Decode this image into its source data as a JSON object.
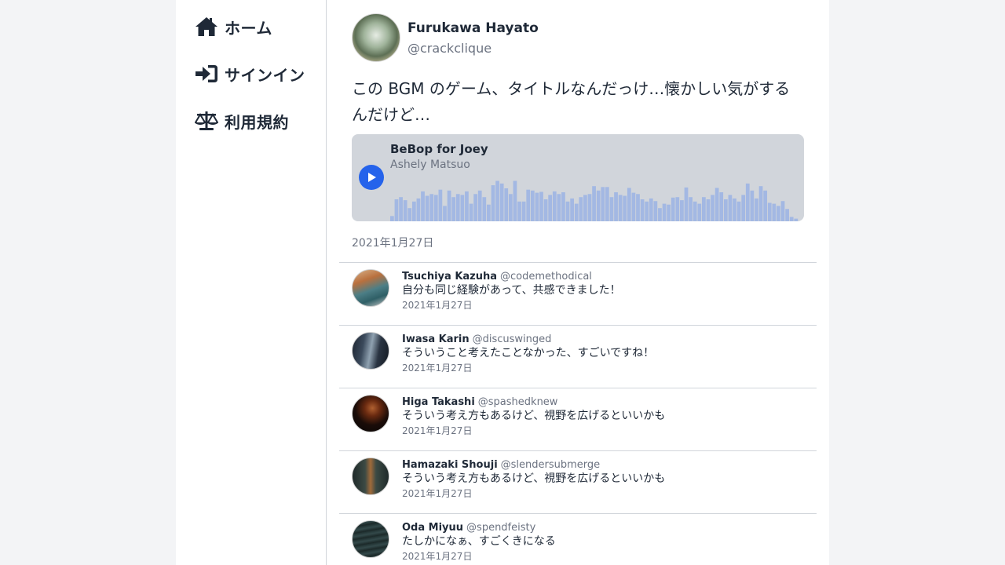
{
  "sidebar": {
    "items": [
      {
        "label": "ホーム",
        "icon": "home-icon"
      },
      {
        "label": "サインイン",
        "icon": "sign-in-icon"
      },
      {
        "label": "利用規約",
        "icon": "scale-icon"
      }
    ]
  },
  "post": {
    "author_name": "Furukawa Hayato",
    "author_handle": "@crackclique",
    "text": "この BGM のゲーム、タイトルなんだっけ…懐かしい気がするんだけど…",
    "date": "2021年1月27日",
    "audio": {
      "title": "BeBop for Joey",
      "artist": "Ashely Matsuo",
      "play_icon": "play-icon",
      "waveform_levels": [
        0.12,
        0.5,
        0.55,
        0.48,
        0.3,
        0.45,
        0.52,
        0.68,
        0.58,
        0.62,
        0.6,
        0.72,
        0.35,
        0.7,
        0.55,
        0.62,
        0.6,
        0.68,
        0.4,
        0.62,
        0.7,
        0.55,
        0.38,
        0.82,
        0.92,
        0.86,
        0.75,
        0.62,
        0.92,
        0.45,
        0.45,
        0.72,
        0.7,
        0.65,
        0.67,
        0.5,
        0.6,
        0.68,
        0.62,
        0.66,
        0.45,
        0.52,
        0.4,
        0.55,
        0.6,
        0.62,
        0.8,
        0.7,
        0.78,
        0.78,
        0.55,
        0.66,
        0.6,
        0.58,
        0.76,
        0.65,
        0.62,
        0.5,
        0.45,
        0.52,
        0.46,
        0.3,
        0.4,
        0.38,
        0.54,
        0.55,
        0.48,
        0.77,
        0.55,
        0.45,
        0.4,
        0.55,
        0.5,
        0.6,
        0.76,
        0.66,
        0.5,
        0.6,
        0.52,
        0.45,
        0.6,
        0.86,
        0.7,
        0.52,
        0.8,
        0.7,
        0.42,
        0.4,
        0.35,
        0.46,
        0.28,
        0.1,
        0.06
      ],
      "wave_color": "#a3b8e3"
    }
  },
  "replies": [
    {
      "name": "Tsuchiya Kazuha",
      "handle": "@codemethodical",
      "text": "自分も同じ経験があって、共感できました！",
      "date": "2021年1月27日"
    },
    {
      "name": "Iwasa Karin",
      "handle": "@discuswinged",
      "text": "そういうこと考えたことなかった、すごいですね！",
      "date": "2021年1月27日"
    },
    {
      "name": "Higa Takashi",
      "handle": "@spashedknew",
      "text": "そういう考え方もあるけど、視野を広げるといいかも",
      "date": "2021年1月27日"
    },
    {
      "name": "Hamazaki Shouji",
      "handle": "@slendersubmerge",
      "text": "そういう考え方もあるけど、視野を広げるといいかも",
      "date": "2021年1月27日"
    },
    {
      "name": "Oda Miyuu",
      "handle": "@spendfeisty",
      "text": "たしかになぁ、すごくきになる",
      "date": "2021年1月27日"
    }
  ],
  "colors": {
    "accent": "#2563eb",
    "text": "#1f2937",
    "muted": "#6b7280",
    "background": "#f3f4f6",
    "player_bg": "#d1d5db"
  }
}
